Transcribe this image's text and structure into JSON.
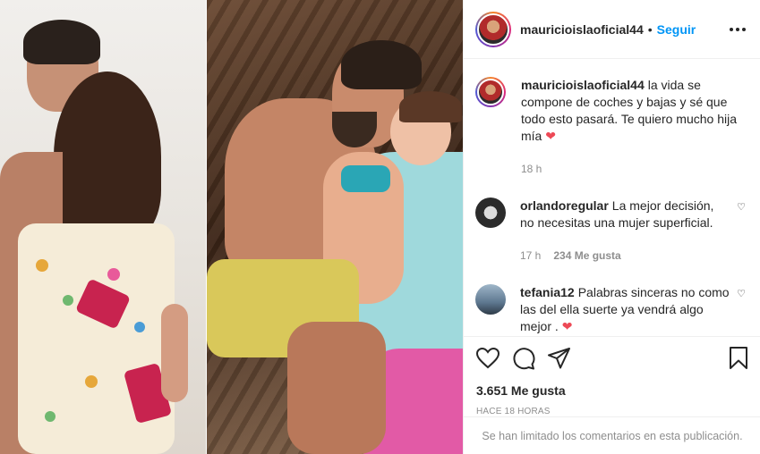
{
  "post": {
    "username": "mauricioislaoficial44",
    "follow_label": "Seguir",
    "separator": "•",
    "caption": "la vida se compone de coches y bajas y sé que todo esto pasará. Te quiero mucho hija mía",
    "caption_emoji": "❤",
    "caption_time": "18 h"
  },
  "comments": [
    {
      "username": "orlandoregular",
      "text": "La mejor decisión, no necesitas una mujer superficial.",
      "time": "17 h",
      "likes": "234 Me gusta"
    },
    {
      "username": "tefania12",
      "text": "Palabras sinceras no como las del ella suerte ya vendrá algo mejor .",
      "emoji": "❤"
    }
  ],
  "actions": {
    "like_icon": "heart-icon",
    "comment_icon": "comment-icon",
    "share_icon": "send-icon",
    "save_icon": "bookmark-icon"
  },
  "likes_count": "3.651 Me gusta",
  "posted_ago": "HACE 18 HORAS",
  "comments_limited": "Se han limitado los comentarios en esta publicación.",
  "colors": {
    "follow_blue": "#0095f6",
    "heart_red": "#ed4956",
    "meta_gray": "#8e8e8e"
  }
}
